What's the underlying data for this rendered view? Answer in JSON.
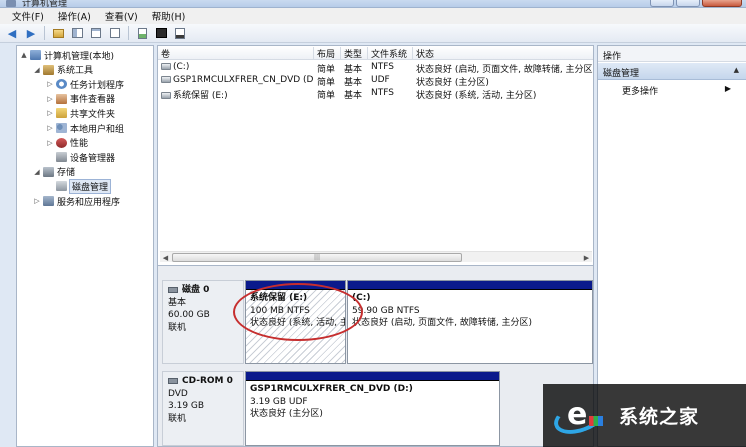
{
  "window": {
    "title": "计算机管理"
  },
  "menu": [
    "文件(F)",
    "操作(A)",
    "查看(V)",
    "帮助(H)"
  ],
  "tree": [
    {
      "label": "计算机管理(本地)",
      "icon": "computer-icon",
      "expander": "▲",
      "level": 0
    },
    {
      "label": "系统工具",
      "icon": "tools-icon",
      "expander": "◢",
      "level": 1
    },
    {
      "label": "任务计划程序",
      "icon": "clock-icon",
      "expander": "▷",
      "level": 2
    },
    {
      "label": "事件查看器",
      "icon": "event-viewer-icon",
      "expander": "▷",
      "level": 2
    },
    {
      "label": "共享文件夹",
      "icon": "shared-folder-icon",
      "expander": "▷",
      "level": 2
    },
    {
      "label": "本地用户和组",
      "icon": "users-icon",
      "expander": "▷",
      "level": 2
    },
    {
      "label": "性能",
      "icon": "performance-icon",
      "expander": "▷",
      "level": 2
    },
    {
      "label": "设备管理器",
      "icon": "device-manager-icon",
      "expander": "",
      "level": 2
    },
    {
      "label": "存储",
      "icon": "storage-icon",
      "expander": "◢",
      "level": 1
    },
    {
      "label": "磁盘管理",
      "icon": "disk-management-icon",
      "expander": "",
      "level": 2,
      "selected": true
    },
    {
      "label": "服务和应用程序",
      "icon": "services-icon",
      "expander": "▷",
      "level": 1
    }
  ],
  "volume_list": {
    "headers": [
      "卷",
      "布局",
      "类型",
      "文件系统",
      "状态"
    ],
    "rows": [
      [
        "(C:)",
        "简单",
        "基本",
        "NTFS",
        "状态良好 (启动, 页面文件, 故障转储, 主分区)"
      ],
      [
        "GSP1RMCULXFRER_CN_DVD (D:)",
        "简单",
        "基本",
        "UDF",
        "状态良好 (主分区)"
      ],
      [
        "系统保留 (E:)",
        "简单",
        "基本",
        "NTFS",
        "状态良好 (系统, 活动, 主分区)"
      ]
    ]
  },
  "disks": [
    {
      "name": "磁盘 0",
      "type": "基本",
      "size": "60.00 GB",
      "status": "联机",
      "partitions": [
        {
          "name": "系统保留 (E:)",
          "size": "100 MB NTFS",
          "status": "状态良好 (系统, 活动, 主",
          "hatched": true
        },
        {
          "name": "(C:)",
          "size": "59.90 GB NTFS",
          "status": "状态良好 (启动, 页面文件, 故障转储, 主分区)",
          "hatched": false
        }
      ]
    },
    {
      "name": "CD-ROM 0",
      "type": "DVD",
      "size": "3.19 GB",
      "status": "联机",
      "partitions": [
        {
          "name": "GSP1RMCULXFRER_CN_DVD (D:)",
          "size": "3.19 GB UDF",
          "status": "状态良好 (主分区)",
          "hatched": false
        }
      ]
    }
  ],
  "actions": {
    "header": "操作",
    "section": "磁盘管理",
    "items": [
      "更多操作"
    ]
  },
  "watermark": {
    "text": "系统之家"
  },
  "colors": {
    "partition_bar": "#0a1a8c",
    "highlight_circle": "#c62e2e",
    "selection": "#dfe8f5"
  }
}
